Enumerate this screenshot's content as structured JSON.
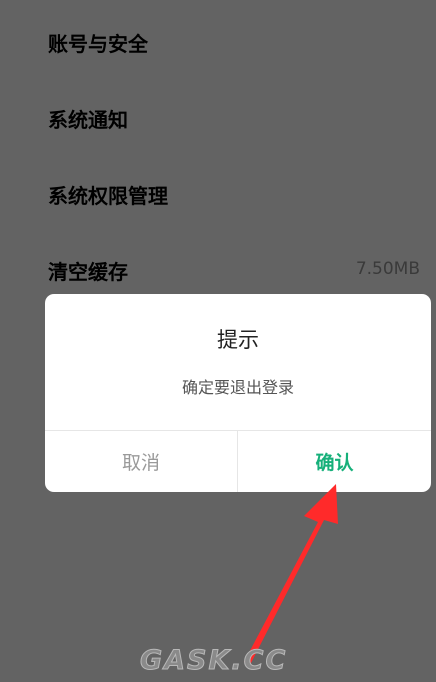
{
  "settings": {
    "items": [
      {
        "label": "账号与安全",
        "value": ""
      },
      {
        "label": "系统通知",
        "value": ""
      },
      {
        "label": "系统权限管理",
        "value": ""
      },
      {
        "label": "清空缓存",
        "value": "7.50MB"
      }
    ]
  },
  "dialog": {
    "title": "提示",
    "message": "确定要退出登录",
    "cancel_label": "取消",
    "confirm_label": "确认"
  },
  "annotation": {
    "arrow_color": "#ff2a2a",
    "arrow_icon": "red-arrow-icon"
  },
  "watermark": {
    "text": "GASK.CC"
  },
  "colors": {
    "overlay": "#636363",
    "dialog_bg": "#ffffff",
    "confirm_accent": "#16b07a",
    "cancel_text": "#9a9a9a"
  }
}
